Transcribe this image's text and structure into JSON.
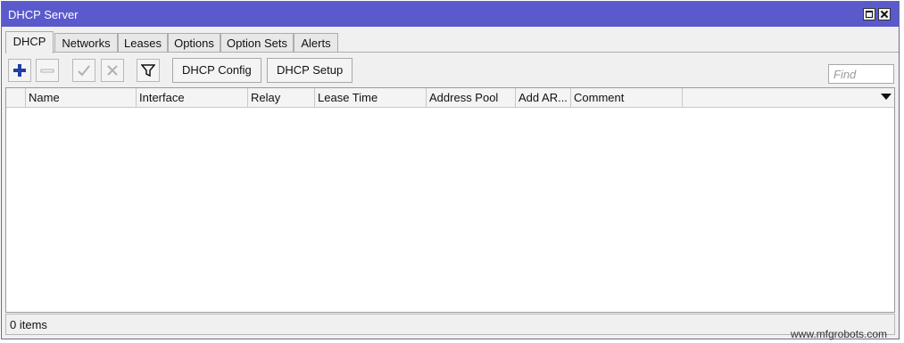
{
  "window": {
    "title": "DHCP Server",
    "colors": {
      "titlebar": "#5a5acd",
      "accent_plus": "#1f3fa6"
    }
  },
  "tabs": [
    {
      "label": "DHCP",
      "active": true
    },
    {
      "label": "Networks"
    },
    {
      "label": "Leases"
    },
    {
      "label": "Options"
    },
    {
      "label": "Option Sets"
    },
    {
      "label": "Alerts"
    }
  ],
  "toolbar": {
    "icons": [
      "add-icon",
      "remove-icon",
      "enable-icon",
      "disable-icon",
      "filter-icon"
    ],
    "dhcp_config_label": "DHCP Config",
    "dhcp_setup_label": "DHCP Setup",
    "find_placeholder": "Find"
  },
  "table": {
    "columns": [
      "Name",
      "Interface",
      "Relay",
      "Lease Time",
      "Address Pool",
      "Add AR...",
      "Comment"
    ],
    "sort_marker": "/",
    "rows": []
  },
  "status": {
    "items_text": "0 items"
  },
  "watermark": "www.mfgrobots.com"
}
